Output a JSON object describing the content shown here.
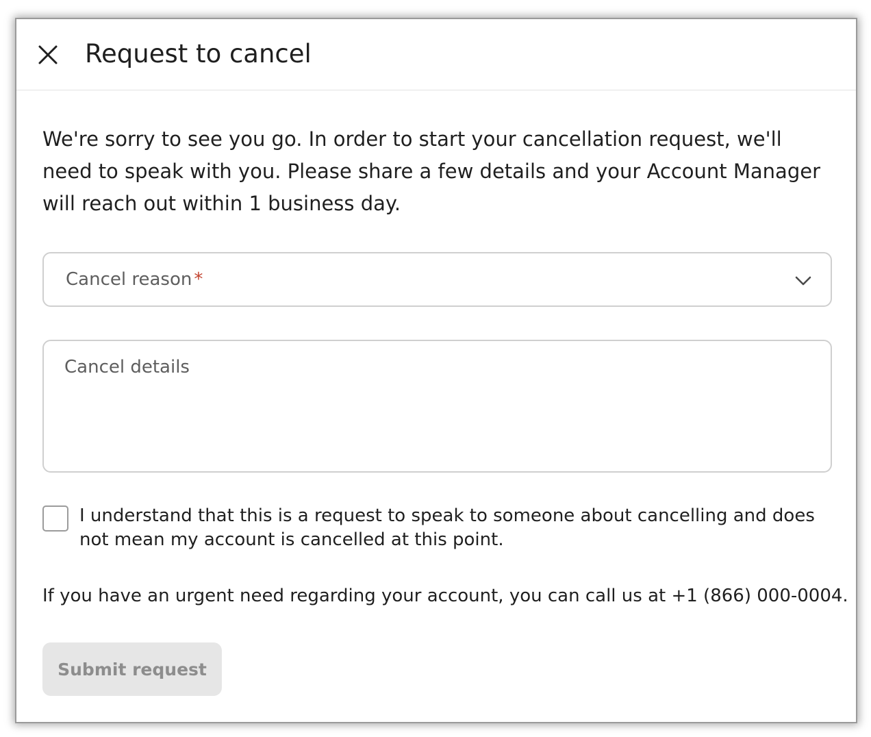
{
  "dialog": {
    "title": "Request to cancel",
    "close_icon": "close-icon",
    "intro": "We're sorry to see you go. In order to start your cancellation request, we'll need to speak with you. Please share a few details and your Account Manager will reach out within 1 business day."
  },
  "form": {
    "cancel_reason": {
      "label": "Cancel reason",
      "required_mark": "*",
      "icon": "chevron-down-icon"
    },
    "cancel_details": {
      "placeholder": "Cancel details",
      "value": ""
    },
    "acknowledge": {
      "checked": false,
      "label": "I understand that this is a request to speak to someone about cancelling and does not mean my account is cancelled at this point."
    },
    "urgent_note": "If you have an urgent need regarding your account, you can call us at +1 (866) 000-0004.",
    "submit_label": "Submit request"
  },
  "colors": {
    "required": "#c2432f",
    "submit_disabled_bg": "#e6e6e6",
    "submit_disabled_text": "#8d8d8d",
    "border": "#cfcfcf"
  }
}
